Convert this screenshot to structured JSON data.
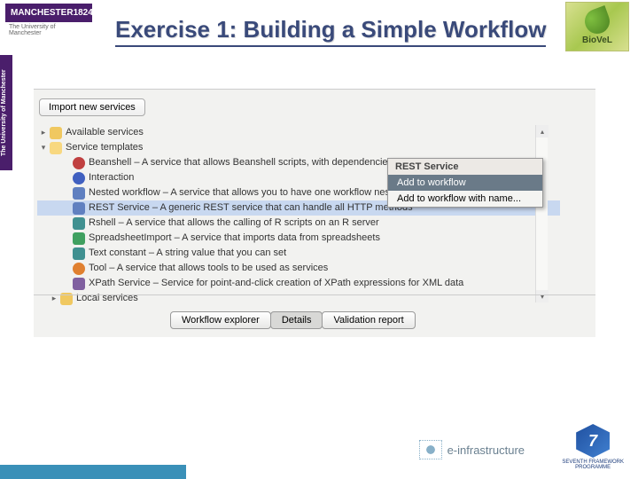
{
  "header": {
    "manchester_name": "MANCHESTER",
    "manchester_year": "1824",
    "manchester_sub": "The University of Manchester",
    "vertical": "The University of Manchester",
    "biovel": "BioVeL",
    "title": "Exercise 1: Building a Simple Workflow"
  },
  "panel": {
    "import_btn": "Import new services",
    "tree": {
      "available": "Available services",
      "templates": "Service templates",
      "items": [
        "Beanshell – A service that allows Beanshell scripts, with dependencies on libraries",
        "Interaction",
        "Nested workflow – A service that allows you to have one workflow nested within another",
        "REST Service – A generic REST service that can handle all HTTP methods",
        "Rshell – A service that allows the calling of R scripts on an R server",
        "SpreadsheetImport – A service that imports data from spreadsheets",
        "Text constant – A string value that you can set",
        "Tool – A service that allows tools to be used as services",
        "XPath Service – Service for point-and-click creation of XPath expressions for XML data"
      ],
      "local": "Local services"
    },
    "context": {
      "title": "REST Service",
      "add": "Add to workflow",
      "add_name": "Add to workflow with name..."
    },
    "tabs": {
      "explorer": "Workflow explorer",
      "details": "Details",
      "validation": "Validation report"
    }
  },
  "footer": {
    "einfra": "e-infrastructure",
    "fp7_num": "7",
    "fp7_label": "SEVENTH FRAMEWORK",
    "fp7_sub": "PROGRAMME"
  }
}
